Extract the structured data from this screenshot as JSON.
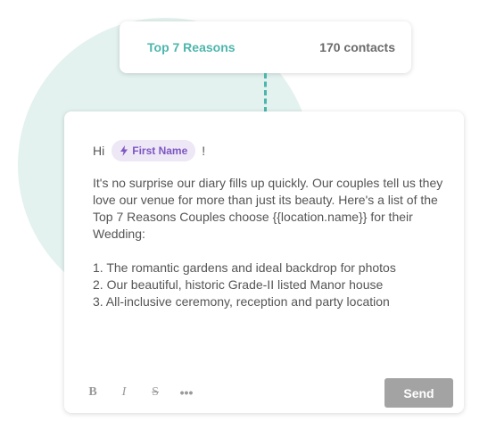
{
  "segment": {
    "name": "Top 7 Reasons",
    "count": "170 contacts"
  },
  "message": {
    "greeting_prefix": "Hi",
    "merge_tag_label": "First Name",
    "greeting_suffix": "!",
    "paragraph": "It's no surprise our diary fills up quickly. Our couples tell us they love our venue for more than just its beauty. Here's a list of the Top 7 Reasons Couples choose {{location.name}} for their Wedding:",
    "list_items": [
      "1. The romantic gardens and ideal backdrop for photos",
      "2. Our beautiful, historic Grade-II listed Manor house",
      "3. All-inclusive ceremony, reception and party location"
    ]
  },
  "toolbar": {
    "bold_label": "B",
    "italic_label": "I",
    "strike_label": "S",
    "more_label": "•••",
    "send_label": "Send"
  },
  "icons": {
    "merge_tag": "lightning-bolt-icon"
  },
  "colors": {
    "accent_teal": "#4db6ac",
    "background_circle": "#e3f2ef",
    "chip_background": "#ede7f6",
    "chip_text": "#7e57c2",
    "send_button": "#a3a3a3"
  }
}
